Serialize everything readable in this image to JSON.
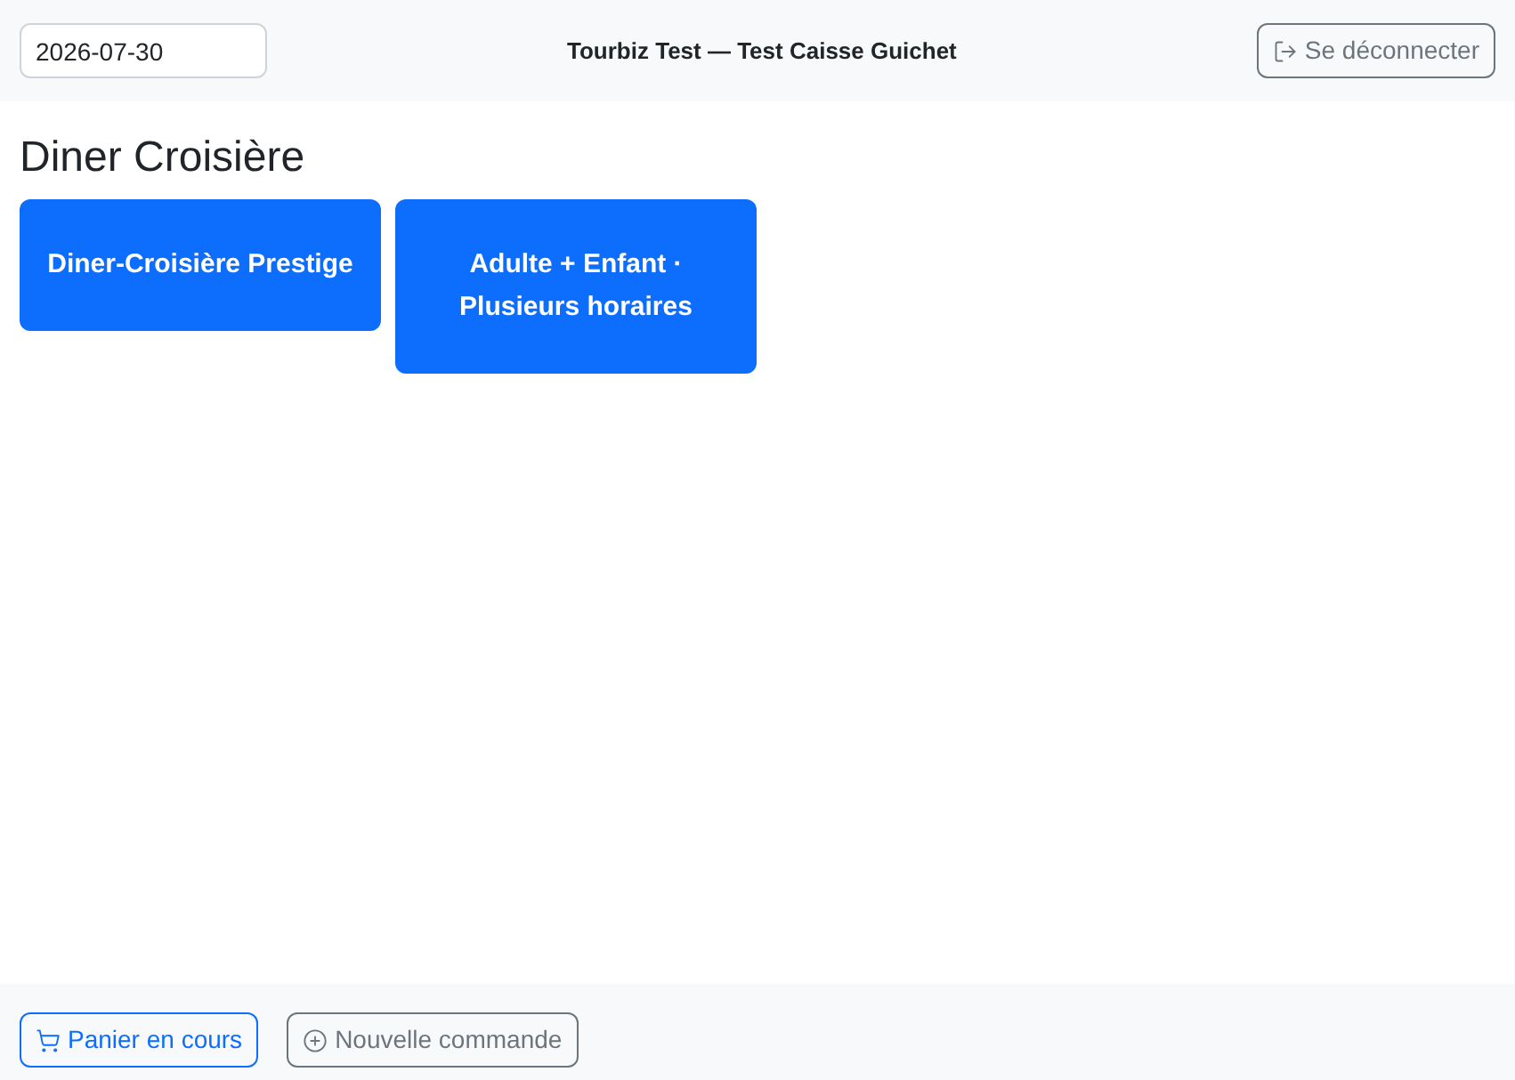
{
  "header": {
    "date_field": {
      "value": "2026-07-30"
    },
    "title": "Tourbiz Test — Test Caisse Guichet",
    "logout_button": {
      "label": "Se déconnecter"
    }
  },
  "section": {
    "heading": "Diner Croisière",
    "products": [
      {
        "label": "Diner-Croisière Prestige"
      },
      {
        "label": "Adulte + Enfant · Plusieurs horaires"
      }
    ]
  },
  "footer": {
    "buttons": [
      {
        "kind": "cart",
        "label": "Panier en cours"
      },
      {
        "kind": "new",
        "label": "Nouvelle commande"
      }
    ]
  }
}
